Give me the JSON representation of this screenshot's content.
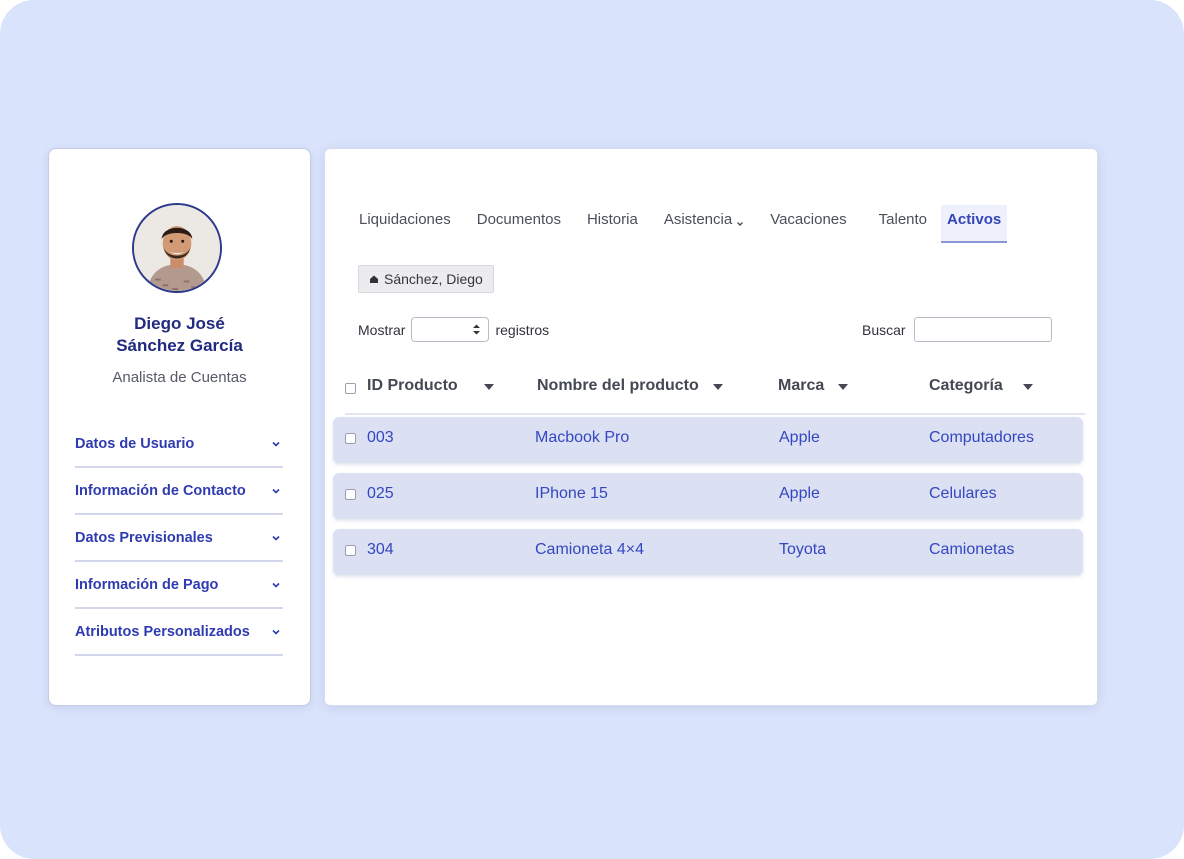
{
  "profile": {
    "name_line1": "Diego José",
    "name_line2": "Sánchez García",
    "role": "Analista de Cuentas",
    "menu": [
      {
        "label": "Datos de Usuario"
      },
      {
        "label": "Información de Contacto"
      },
      {
        "label": "Datos Previsionales"
      },
      {
        "label": "Información de Pago"
      },
      {
        "label": "Atributos Personalizados"
      }
    ]
  },
  "tabs": [
    {
      "label": "Liquidaciones"
    },
    {
      "label": "Documentos"
    },
    {
      "label": "Historia"
    },
    {
      "label": "Asistencia"
    },
    {
      "label": "Vacaciones"
    },
    {
      "label": "Talento"
    },
    {
      "label": "Activos"
    }
  ],
  "active_tab": "Activos",
  "chip": {
    "label": "Sánchez, Diego"
  },
  "controls": {
    "show_label": "Mostrar",
    "show_value": "",
    "records_label": "registros",
    "search_label": "Buscar",
    "search_value": ""
  },
  "table": {
    "headers": [
      "ID Producto",
      "Nombre del producto",
      "Marca",
      "Categoría"
    ],
    "rows": [
      {
        "id": "003",
        "name": "Macbook Pro",
        "brand": "Apple",
        "category": "Computadores"
      },
      {
        "id": "025",
        "name": "IPhone 15",
        "brand": "Apple",
        "category": "Celulares"
      },
      {
        "id": "304",
        "name": "Camioneta 4×4",
        "brand": "Toyota",
        "category": "Camionetas"
      }
    ]
  },
  "colors": {
    "background": "#d9e3fb",
    "accent": "#3345b8",
    "row_bg": "#dbe0f3",
    "name": "#1f2a80"
  },
  "icons": {
    "avatar": "user-photo",
    "menu_chevron": "chevron-down-icon",
    "tab_chevron": "chevron-down-icon",
    "chip": "home-icon",
    "select": "updown-icon",
    "sort": "caret-down-icon"
  }
}
